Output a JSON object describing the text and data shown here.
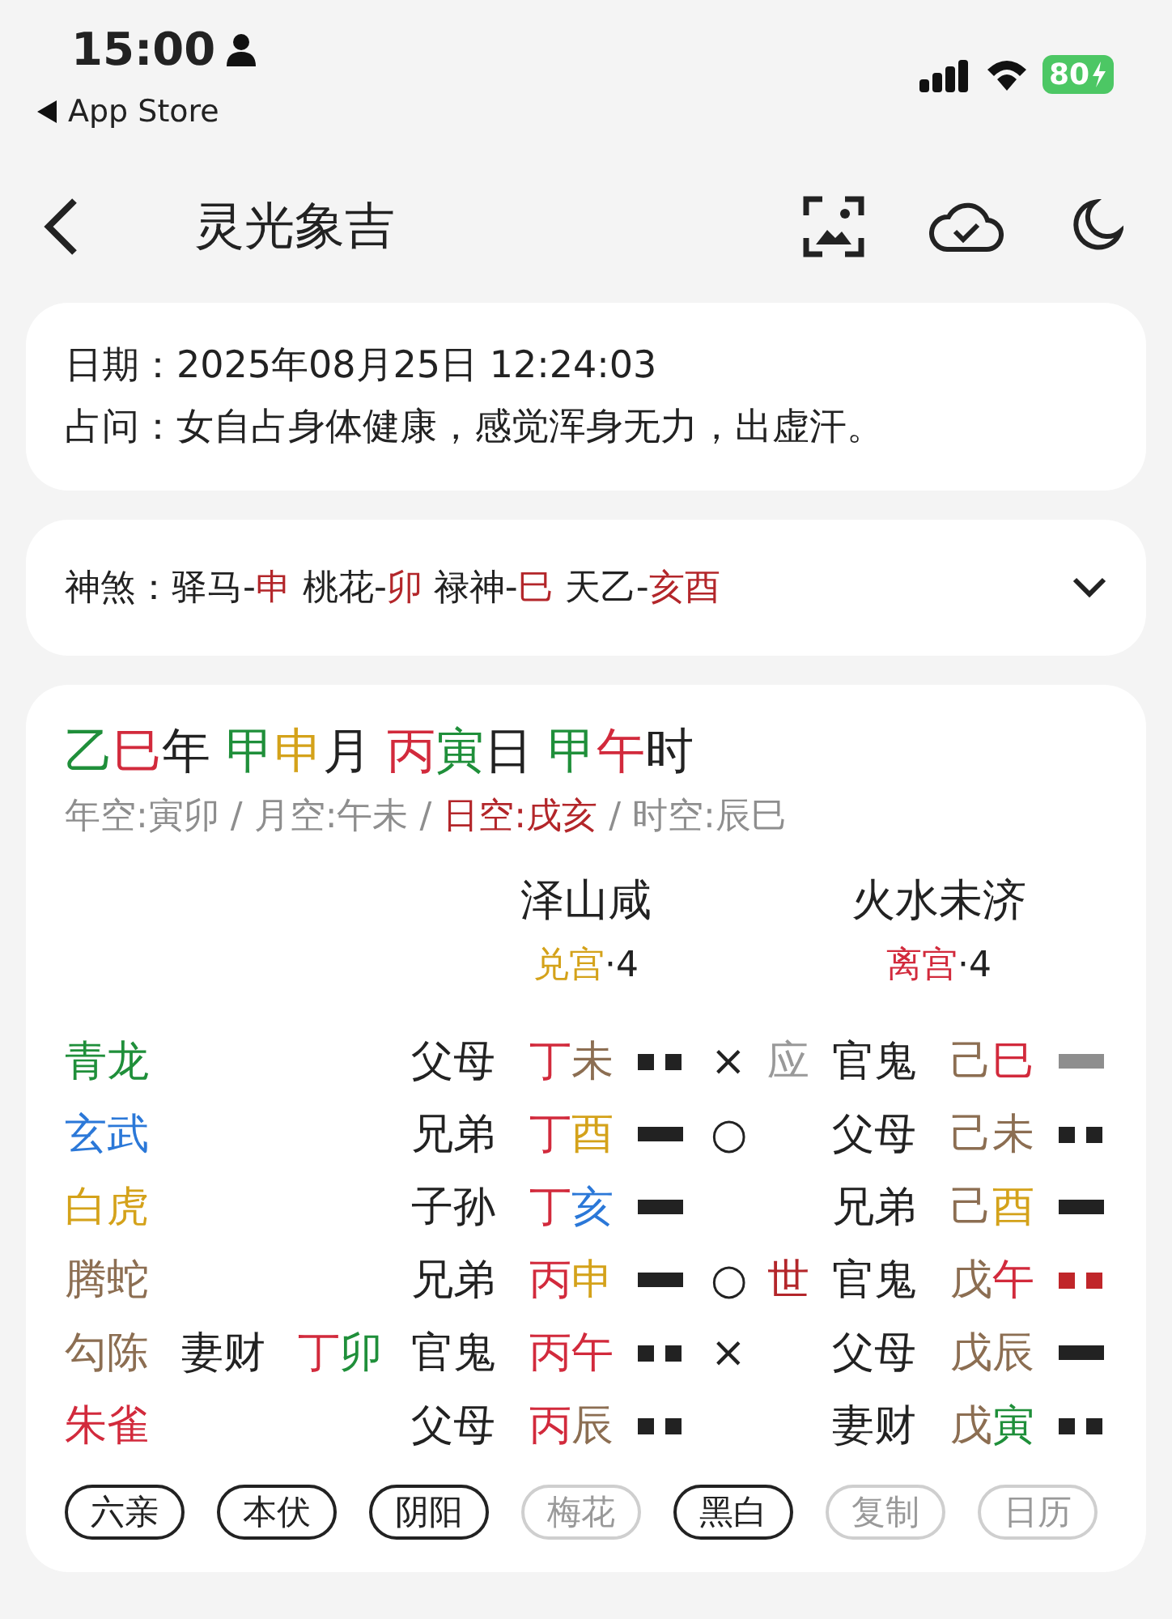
{
  "status_bar": {
    "time": "15:00",
    "back_app": "App Store",
    "battery": "80"
  },
  "nav": {
    "title": "灵光象吉"
  },
  "info": [
    {
      "label": "日期：",
      "value": "2025年08月25日 12:24:03"
    },
    {
      "label": "占问：",
      "value": "女自占身体健康，感觉浑身无力，出虚汗。"
    }
  ],
  "shensha": {
    "label": "神煞：",
    "items": [
      {
        "text": "驿马-",
        "color": "#222222"
      },
      {
        "text": "申",
        "color": "#b3262a"
      },
      {
        "text": " 桃花-",
        "color": "#222222"
      },
      {
        "text": "卯",
        "color": "#b3262a"
      },
      {
        "text": " 禄神-",
        "color": "#222222"
      },
      {
        "text": "巳",
        "color": "#b3262a"
      },
      {
        "text": " 天乙-",
        "color": "#222222"
      },
      {
        "text": "亥酉",
        "color": "#b3262a"
      }
    ]
  },
  "pillars": [
    {
      "text": "乙",
      "color": "#1f8f3a"
    },
    {
      "text": "巳",
      "color": "#d22a3c"
    },
    {
      "text": "年 ",
      "color": "#222222"
    },
    {
      "text": "甲",
      "color": "#1f8f3a"
    },
    {
      "text": "申",
      "color": "#d4a21a"
    },
    {
      "text": "月 ",
      "color": "#222222"
    },
    {
      "text": "丙",
      "color": "#d22a3c"
    },
    {
      "text": "寅",
      "color": "#1f8f3a"
    },
    {
      "text": "日 ",
      "color": "#222222"
    },
    {
      "text": "甲",
      "color": "#1f8f3a"
    },
    {
      "text": "午",
      "color": "#d22a3c"
    },
    {
      "text": "时",
      "color": "#222222"
    }
  ],
  "kong": [
    {
      "text": "年空:寅卯",
      "color": "#8e8e8e"
    },
    {
      "text": " / ",
      "color": "#8e8e8e"
    },
    {
      "text": "月空:午未",
      "color": "#8e8e8e"
    },
    {
      "text": " / ",
      "color": "#8e8e8e"
    },
    {
      "text": "日空:戌亥",
      "color": "#b3262a"
    },
    {
      "text": " / ",
      "color": "#8e8e8e"
    },
    {
      "text": "时空:辰巳",
      "color": "#8e8e8e"
    }
  ],
  "hexagrams": [
    {
      "name": "泽山咸",
      "palace": "兑宫",
      "color": "#d4a21a",
      "number": "·4"
    },
    {
      "name": "火水未济",
      "palace": "离宫",
      "color": "#d22a3c",
      "number": "·4"
    }
  ],
  "lines": [
    {
      "spirit": {
        "text": "青龙",
        "color": "#1f8f3a"
      },
      "main": {
        "relation": "父母",
        "ganzhi": [
          {
            "text": "丁",
            "color": "#d22a3c"
          },
          {
            "text": "未",
            "color": "#8c6e52"
          }
        ],
        "kind": "yin",
        "color": "#222222"
      },
      "mark": "×",
      "shi_ying": {
        "text": "应",
        "color": "#999999"
      },
      "changed": {
        "relation": "官鬼",
        "ganzhi": [
          {
            "text": "己",
            "color": "#8c6e52"
          },
          {
            "text": "巳",
            "color": "#d22a3c"
          }
        ],
        "kind": "yang",
        "color": "#8e8e8e"
      }
    },
    {
      "spirit": {
        "text": "玄武",
        "color": "#2b78d8"
      },
      "main": {
        "relation": "兄弟",
        "ganzhi": [
          {
            "text": "丁",
            "color": "#d22a3c"
          },
          {
            "text": "酉",
            "color": "#d4a21a"
          }
        ],
        "kind": "yang",
        "color": "#222222"
      },
      "mark": "○",
      "changed": {
        "relation": "父母",
        "ganzhi": [
          {
            "text": "己",
            "color": "#8c6e52"
          },
          {
            "text": "未",
            "color": "#8c6e52"
          }
        ],
        "kind": "yin",
        "color": "#222222"
      }
    },
    {
      "spirit": {
        "text": "白虎",
        "color": "#d4a21a"
      },
      "main": {
        "relation": "子孙",
        "ganzhi": [
          {
            "text": "丁",
            "color": "#d22a3c"
          },
          {
            "text": "亥",
            "color": "#2b78d8"
          }
        ],
        "kind": "yang",
        "color": "#222222"
      },
      "changed": {
        "relation": "兄弟",
        "ganzhi": [
          {
            "text": "己",
            "color": "#8c6e52"
          },
          {
            "text": "酉",
            "color": "#d4a21a"
          }
        ],
        "kind": "yang",
        "color": "#222222"
      }
    },
    {
      "spirit": {
        "text": "腾蛇",
        "color": "#8c6e52"
      },
      "main": {
        "relation": "兄弟",
        "ganzhi": [
          {
            "text": "丙",
            "color": "#d22a3c"
          },
          {
            "text": "申",
            "color": "#d4a21a"
          }
        ],
        "kind": "yang",
        "color": "#222222"
      },
      "mark": "○",
      "shi_ying": {
        "text": "世",
        "color": "#b3262a"
      },
      "changed": {
        "relation": "官鬼",
        "ganzhi": [
          {
            "text": "戊",
            "color": "#8c6e52"
          },
          {
            "text": "午",
            "color": "#d22a3c"
          }
        ],
        "kind": "yin",
        "color": "#c0262a"
      }
    },
    {
      "spirit": {
        "text": "勾陈",
        "color": "#8c6e52"
      },
      "hidden": {
        "relation": "妻财",
        "ganzhi": [
          {
            "text": "丁",
            "color": "#d22a3c"
          },
          {
            "text": "卯",
            "color": "#1f8f3a"
          }
        ]
      },
      "main": {
        "relation": "官鬼",
        "ganzhi": [
          {
            "text": "丙",
            "color": "#d22a3c"
          },
          {
            "text": "午",
            "color": "#d22a3c"
          }
        ],
        "kind": "yin",
        "color": "#222222"
      },
      "mark": "×",
      "changed": {
        "relation": "父母",
        "ganzhi": [
          {
            "text": "戊",
            "color": "#8c6e52"
          },
          {
            "text": "辰",
            "color": "#8c6e52"
          }
        ],
        "kind": "yang",
        "color": "#222222"
      }
    },
    {
      "spirit": {
        "text": "朱雀",
        "color": "#d22a3c"
      },
      "main": {
        "relation": "父母",
        "ganzhi": [
          {
            "text": "丙",
            "color": "#d22a3c"
          },
          {
            "text": "辰",
            "color": "#8c6e52"
          }
        ],
        "kind": "yin",
        "color": "#222222"
      },
      "changed": {
        "relation": "妻财",
        "ganzhi": [
          {
            "text": "戊",
            "color": "#8c6e52"
          },
          {
            "text": "寅",
            "color": "#1f8f3a"
          }
        ],
        "kind": "yin",
        "color": "#222222"
      }
    }
  ],
  "tabs": [
    {
      "label": "六亲",
      "disabled": false
    },
    {
      "label": "本伏",
      "disabled": false
    },
    {
      "label": "阴阳",
      "disabled": false
    },
    {
      "label": "梅花",
      "disabled": true
    },
    {
      "label": "黑白",
      "disabled": false
    },
    {
      "label": "复制",
      "disabled": true
    },
    {
      "label": "日历",
      "disabled": true
    }
  ]
}
